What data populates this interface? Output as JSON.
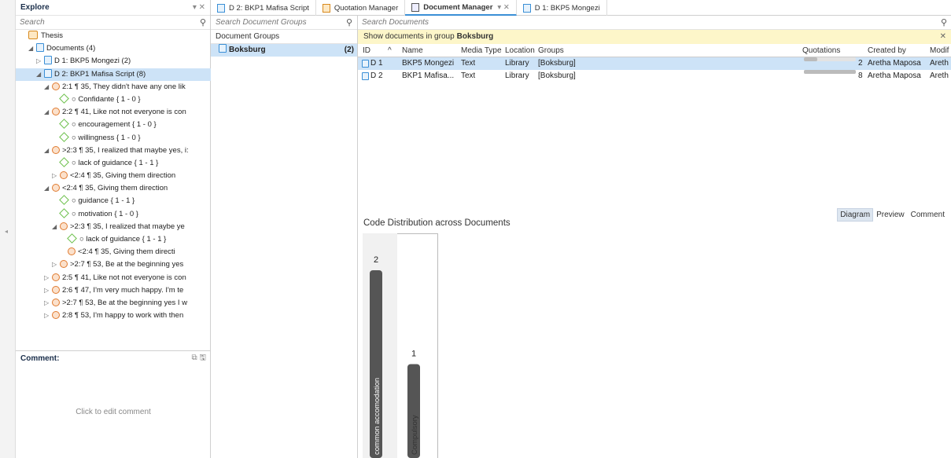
{
  "explore": {
    "title": "Explore",
    "controls": "▾ ✕",
    "search_placeholder": "Search",
    "tree": [
      {
        "indent": 0,
        "icon": "cube",
        "text": "Thesis"
      },
      {
        "indent": 1,
        "icon": "doc",
        "expander": "◢",
        "text": "Documents (4)"
      },
      {
        "indent": 2,
        "icon": "doc",
        "expander": "▷",
        "text": "D 1: BKP5 Mongezi (2)"
      },
      {
        "indent": 2,
        "icon": "doc",
        "expander": "◢",
        "text": "D 2: BKP1 Mafisa Script (8)",
        "selected": true
      },
      {
        "indent": 3,
        "icon": "quote",
        "expander": "◢",
        "text": "2:1 ¶ 35, They didn't have any one lik"
      },
      {
        "indent": 4,
        "icon": "code",
        "text": "○ Confidante { 1 - 0 }"
      },
      {
        "indent": 3,
        "icon": "quote",
        "expander": "◢",
        "text": "2:2 ¶ 41, Like not not everyone is con"
      },
      {
        "indent": 4,
        "icon": "code",
        "text": "○ encouragement { 1 - 0 }"
      },
      {
        "indent": 4,
        "icon": "code",
        "text": "○ willingness { 1 - 0 }"
      },
      {
        "indent": 3,
        "icon": "quote",
        "expander": "◢",
        "text": ">2:3 ¶ 35, I realized that maybe yes, i:"
      },
      {
        "indent": 4,
        "icon": "code",
        "text": "○ lack of guidance { 1 - 1 }"
      },
      {
        "indent": 4,
        "icon": "quote",
        "expander": "▷",
        "text": "<2:4 ¶ 35, Giving them direction"
      },
      {
        "indent": 3,
        "icon": "quote",
        "expander": "◢",
        "text": "<2:4 ¶ 35, Giving them direction"
      },
      {
        "indent": 4,
        "icon": "code",
        "text": "○ guidance { 1 - 1 }"
      },
      {
        "indent": 4,
        "icon": "code",
        "text": "○ motivation { 1 - 0 }"
      },
      {
        "indent": 4,
        "icon": "quote",
        "expander": "◢",
        "text": ">2:3 ¶ 35, I realized that maybe ye"
      },
      {
        "indent": 5,
        "icon": "code",
        "text": "○ lack of guidance { 1 - 1 }"
      },
      {
        "indent": 5,
        "icon": "quote",
        "text": "<2:4 ¶ 35, Giving them directi"
      },
      {
        "indent": 4,
        "icon": "quote",
        "expander": "▷",
        "text": ">2:7 ¶ 53, Be at the beginning yes"
      },
      {
        "indent": 3,
        "icon": "quote",
        "expander": "▷",
        "text": "2:5 ¶ 41, Like not not everyone is con"
      },
      {
        "indent": 3,
        "icon": "quote",
        "expander": "▷",
        "text": "2:6 ¶ 47, I'm very much happy. I'm te"
      },
      {
        "indent": 3,
        "icon": "quote",
        "expander": "▷",
        "text": ">2:7 ¶ 53, Be at the beginning yes I w"
      },
      {
        "indent": 3,
        "icon": "quote",
        "expander": "▷",
        "text": "2:8 ¶ 53, I'm happy to work with then"
      }
    ],
    "comment_label": "Comment:",
    "comment_placeholder": "Click to edit comment"
  },
  "tabs": [
    {
      "label": "D 2: BKP1 Mafisa Script",
      "icon": "doc"
    },
    {
      "label": "Quotation Manager",
      "icon": "qm"
    },
    {
      "label": "Document Manager",
      "icon": "dm",
      "active": true,
      "extra": "▾ ✕"
    },
    {
      "label": "D 1: BKP5 Mongezi",
      "icon": "doc"
    }
  ],
  "groups": {
    "search_placeholder": "Search Document Groups",
    "header": "Document Groups",
    "items": [
      {
        "name": "Boksburg",
        "count": "(2)"
      }
    ]
  },
  "documents": {
    "search_placeholder": "Search Documents",
    "banner_prefix": "Show documents in group",
    "banner_group": "Boksburg",
    "columns": {
      "id": "ID",
      "sort": "^",
      "name": "Name",
      "media": "Media Type",
      "location": "Location",
      "groups": "Groups",
      "quotations": "Quotations",
      "created": "Created by",
      "modified": "Modif"
    },
    "rows": [
      {
        "id": "D 1",
        "name": "BKP5 Mongezi",
        "media": "Text",
        "location": "Library",
        "groups": "[Boksburg]",
        "quotations": "2",
        "quot_fill": 0.25,
        "created": "Aretha Maposa",
        "modified": "Areth",
        "selected": true
      },
      {
        "id": "D 2",
        "name": "BKP1 Mafisa...",
        "media": "Text",
        "location": "Library",
        "groups": "[Boksburg]",
        "quotations": "8",
        "quot_fill": 1.0,
        "created": "Aretha Maposa",
        "modified": "Areth"
      }
    ],
    "view_tabs": [
      "Diagram",
      "Preview",
      "Comment"
    ],
    "active_view": "Diagram"
  },
  "chart_data": {
    "type": "bar",
    "title": "Code Distribution across Documents",
    "categories": [
      "common accomodation",
      "Compulsory"
    ],
    "values": [
      2,
      1
    ],
    "ylim": [
      0,
      2
    ]
  },
  "colors": {
    "selection": "#cde3f7",
    "banner": "#fdf6c9",
    "bar": "#555555",
    "accent": "#3a8fd6"
  }
}
